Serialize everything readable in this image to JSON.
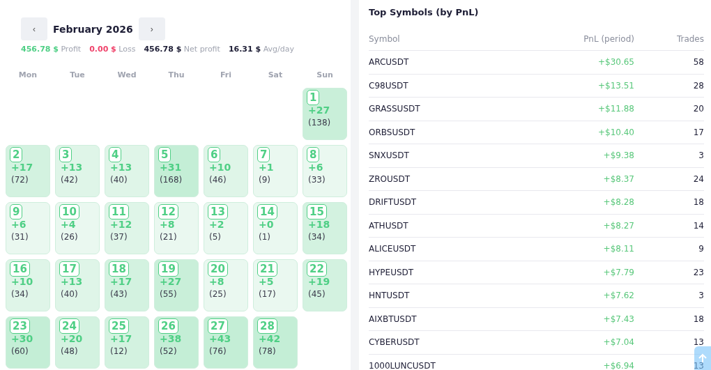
{
  "calendar": {
    "prev": "‹",
    "month": "February 2026",
    "next": "›",
    "summary": [
      {
        "kind": "profit",
        "text": "**456.78 $** Profit"
      },
      {
        "kind": "loss",
        "text": "**0.00 $** Loss"
      },
      {
        "kind": "net",
        "text": "**456.78 $** Net profit"
      },
      {
        "kind": "net",
        "text": "**16.31 $** Avg/day"
      }
    ],
    "weekdays": [
      "Mon",
      "Tue",
      "Wed",
      "Thu",
      "Fri",
      "Sat",
      "Sun"
    ],
    "days": [
      {
        "day": "1",
        "pnl": "+27",
        "count": "(138)",
        "color": "#c9efd9"
      },
      {
        "day": "2",
        "pnl": "+17",
        "count": "(72)",
        "color": "#d3f2e0"
      },
      {
        "day": "3",
        "pnl": "+13",
        "count": "(42)",
        "color": "#dff5e8"
      },
      {
        "day": "4",
        "pnl": "+13",
        "count": "(40)",
        "color": "#dff5e8"
      },
      {
        "day": "5",
        "pnl": "+31",
        "count": "(168)",
        "color": "#c4eed6"
      },
      {
        "day": "6",
        "pnl": "+10",
        "count": "(46)",
        "color": "#dff5e8"
      },
      {
        "day": "7",
        "pnl": "+1",
        "count": "(9)",
        "color": "#eaf8f0"
      },
      {
        "day": "8",
        "pnl": "+6",
        "count": "(33)",
        "color": "#eaf8f0"
      },
      {
        "day": "9",
        "pnl": "+6",
        "count": "(31)",
        "color": "#eaf8f0"
      },
      {
        "day": "10",
        "pnl": "+4",
        "count": "(26)",
        "color": "#eaf8f0"
      },
      {
        "day": "11",
        "pnl": "+12",
        "count": "(37)",
        "color": "#dff5e8"
      },
      {
        "day": "12",
        "pnl": "+8",
        "count": "(21)",
        "color": "#eaf8f0"
      },
      {
        "day": "13",
        "pnl": "+2",
        "count": "(5)",
        "color": "#eaf8f0"
      },
      {
        "day": "14",
        "pnl": "+0",
        "count": "(1)",
        "color": "#eaf8f0"
      },
      {
        "day": "15",
        "pnl": "+18",
        "count": "(34)",
        "color": "#d3f2e0"
      },
      {
        "day": "16",
        "pnl": "+10",
        "count": "(34)",
        "color": "#dff5e8"
      },
      {
        "day": "17",
        "pnl": "+13",
        "count": "(40)",
        "color": "#dff5e8"
      },
      {
        "day": "18",
        "pnl": "+17",
        "count": "(43)",
        "color": "#d3f2e0"
      },
      {
        "day": "19",
        "pnl": "+27",
        "count": "(55)",
        "color": "#c9efd9"
      },
      {
        "day": "20",
        "pnl": "+8",
        "count": "(25)",
        "color": "#eaf8f0"
      },
      {
        "day": "21",
        "pnl": "+5",
        "count": "(17)",
        "color": "#eaf8f0"
      },
      {
        "day": "22",
        "pnl": "+19",
        "count": "(45)",
        "color": "#d3f2e0"
      },
      {
        "day": "23",
        "pnl": "+30",
        "count": "(60)",
        "color": "#c4eed6"
      },
      {
        "day": "24",
        "pnl": "+20",
        "count": "(48)",
        "color": "#d3f2e0"
      },
      {
        "day": "25",
        "pnl": "+17",
        "count": "(12)",
        "color": "#d3f2e0"
      },
      {
        "day": "26",
        "pnl": "+38",
        "count": "(52)",
        "color": "#c4eed6"
      },
      {
        "day": "27",
        "pnl": "+43",
        "count": "(76)",
        "color": "#c4eed6"
      },
      {
        "day": "28",
        "pnl": "+42",
        "count": "(78)",
        "color": "#c4eed6"
      }
    ]
  },
  "top_symbols": {
    "title": "Top Symbols (by PnL)",
    "columns": [
      "Symbol",
      "PnL (period)",
      "Trades"
    ],
    "rows": [
      [
        "ARCUSDT",
        "+$30.65",
        "58"
      ],
      [
        "C98USDT",
        "+$13.51",
        "28"
      ],
      [
        "GRASSUSDT",
        "+$11.88",
        "20"
      ],
      [
        "ORBSUSDT",
        "+$10.40",
        "17"
      ],
      [
        "SNXUSDT",
        "+$9.38",
        "3"
      ],
      [
        "ZROUSDT",
        "+$8.37",
        "24"
      ],
      [
        "DRIFTUSDT",
        "+$8.28",
        "18"
      ],
      [
        "ATHUSDT",
        "+$8.27",
        "14"
      ],
      [
        "ALICEUSDT",
        "+$8.11",
        "9"
      ],
      [
        "HYPEUSDT",
        "+$7.79",
        "23"
      ],
      [
        "HNTUSDT",
        "+$7.62",
        "3"
      ],
      [
        "AIXBTUSDT",
        "+$7.43",
        "18"
      ],
      [
        "CYBERUSDT",
        "+$7.04",
        "13"
      ],
      [
        "1000LUNCUSDT",
        "+$6.94",
        "13"
      ]
    ]
  }
}
